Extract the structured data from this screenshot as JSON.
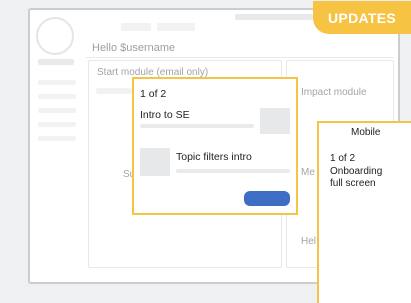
{
  "badge": {
    "label": "UPDATES"
  },
  "page": {
    "greeting": "Hello $username",
    "start_module": "Start module (email only)",
    "impact_module": "Impact module",
    "partial_left": "Su",
    "partial_middle": "Me",
    "partial_bottom": "Hel"
  },
  "popover": {
    "step": "1 of 2",
    "item1": "Intro to SE",
    "item2": "Topic filters intro"
  },
  "mobile": {
    "header": "Mobile",
    "step": "1 of 2",
    "title_line1": "Onboarding",
    "title_line2": "full screen"
  }
}
